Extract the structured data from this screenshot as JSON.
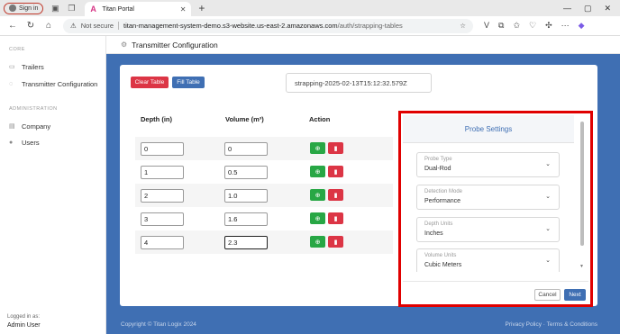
{
  "browser": {
    "sign_in": "Sign in",
    "tab_title": "Titan Portal",
    "new_tab": "+",
    "not_secure": "Not secure",
    "url_host": "titan-management-system-demo.s3-website.us-east-2.amazonaws.com",
    "url_path": "/auth/strapping-tables"
  },
  "sidebar": {
    "core_heading": "CORE",
    "core_items": [
      {
        "label": "Trailers",
        "icon": "trailer-icon"
      },
      {
        "label": "Transmitter Configuration",
        "icon": "circle-icon"
      }
    ],
    "admin_heading": "ADMINISTRATION",
    "admin_items": [
      {
        "label": "Company",
        "icon": "building-icon"
      },
      {
        "label": "Users",
        "icon": "users-icon"
      }
    ],
    "logged_in_as": "Logged in as:",
    "user_name": "Admin User"
  },
  "page": {
    "title": "Transmitter Configuration",
    "clear_table": "Clear Table",
    "fill_table": "Fill Table",
    "file_name": "strapping-2025-02-13T15:12:32.579Z"
  },
  "table": {
    "headers": [
      "Depth (in)",
      "Volume (m³)",
      "Action"
    ],
    "rows": [
      {
        "depth": "0",
        "volume": "0"
      },
      {
        "depth": "1",
        "volume": "0.5"
      },
      {
        "depth": "2",
        "volume": "1.0"
      },
      {
        "depth": "3",
        "volume": "1.6"
      },
      {
        "depth": "4",
        "volume": "2.3"
      }
    ]
  },
  "probe": {
    "title": "Probe Settings",
    "fields": [
      {
        "label": "Probe Type",
        "value": "Dual-Rod"
      },
      {
        "label": "Detection Mode",
        "value": "Performance"
      },
      {
        "label": "Depth Units",
        "value": "Inches"
      },
      {
        "label": "Volume Units",
        "value": "Cubic Meters"
      }
    ],
    "cancel": "Cancel",
    "next": "Next"
  },
  "footer": {
    "copyright": "Copyright © Titan Logix 2024",
    "links": "Privacy Policy · Terms & Conditions"
  },
  "colors": {
    "primary": "#3f6fb3",
    "danger": "#dc3545",
    "success": "#28a745",
    "highlight_frame": "#e00000"
  }
}
